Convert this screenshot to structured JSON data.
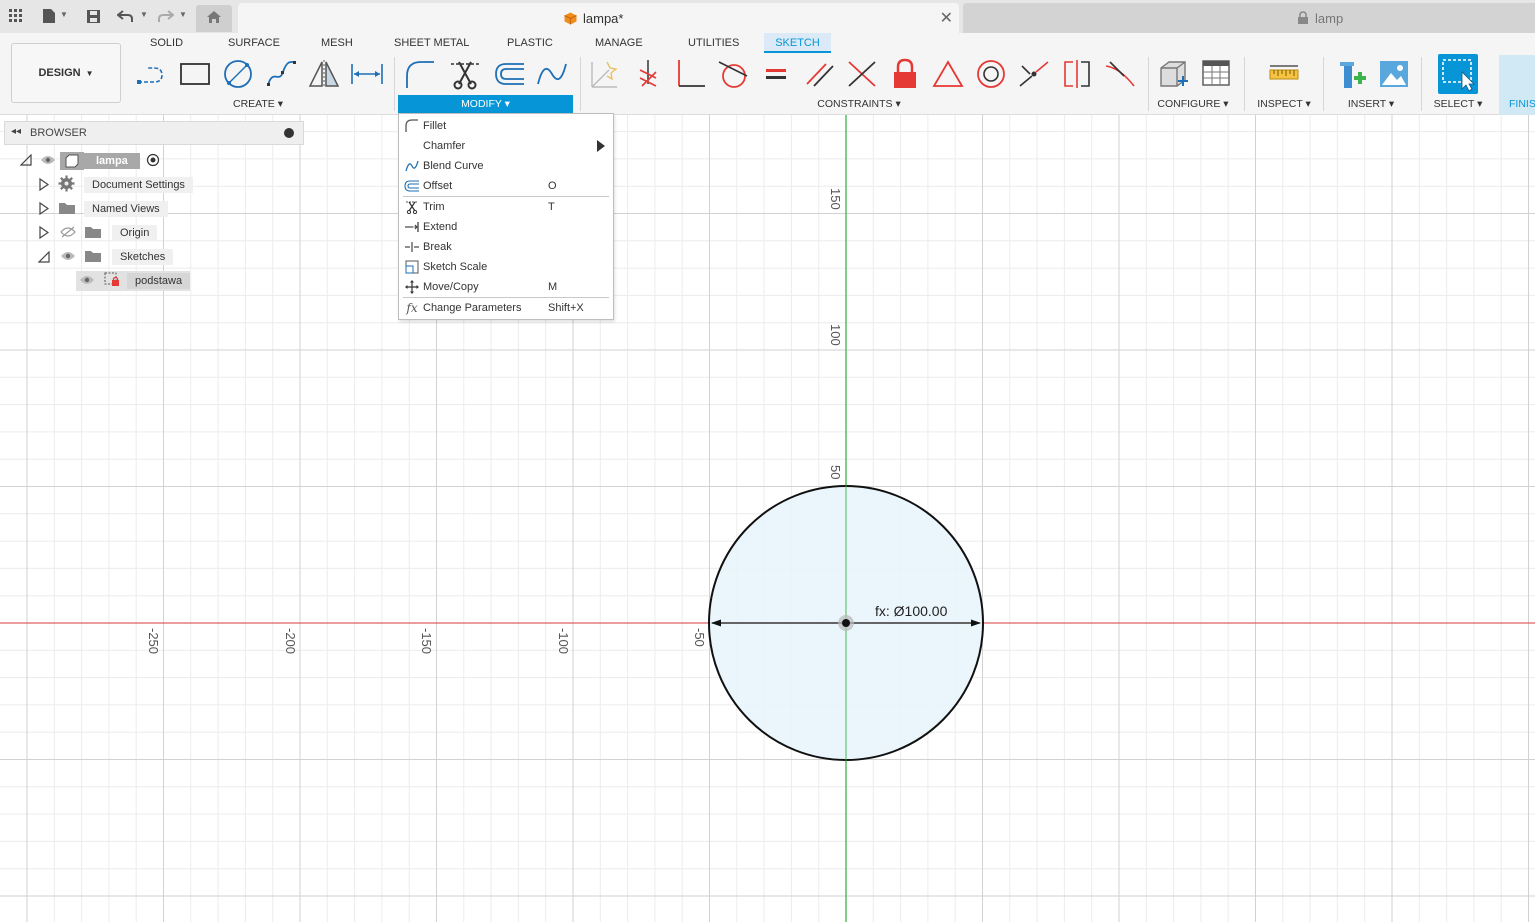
{
  "window": {
    "active_tab": "lampa*",
    "inactive_tab": "lamp"
  },
  "ribbon": {
    "workspace": "DESIGN",
    "tabs": [
      "SOLID",
      "SURFACE",
      "MESH",
      "SHEET METAL",
      "PLASTIC",
      "MANAGE",
      "UTILITIES",
      "SKETCH"
    ],
    "groups": {
      "create": "CREATE",
      "modify": "MODIFY",
      "constraints": "CONSTRAINTS",
      "configure": "CONFIGURE",
      "inspect": "INSPECT",
      "insert": "INSERT",
      "select": "SELECT",
      "finish": "FINISH"
    }
  },
  "browser": {
    "title": "BROWSER",
    "root": "lampa",
    "items": [
      {
        "label": "Document Settings"
      },
      {
        "label": "Named Views"
      },
      {
        "label": "Origin"
      },
      {
        "label": "Sketches"
      },
      {
        "label": "podstawa"
      }
    ]
  },
  "modify_menu": {
    "items": [
      {
        "label": "Fillet",
        "shortcut": ""
      },
      {
        "label": "Chamfer",
        "shortcut": ""
      },
      {
        "label": "Blend Curve",
        "shortcut": ""
      },
      {
        "label": "Offset",
        "shortcut": "O"
      },
      {
        "label": "Trim",
        "shortcut": "T"
      },
      {
        "label": "Extend",
        "shortcut": ""
      },
      {
        "label": "Break",
        "shortcut": ""
      },
      {
        "label": "Sketch Scale",
        "shortcut": ""
      },
      {
        "label": "Move/Copy",
        "shortcut": "M"
      },
      {
        "label": "Change Parameters",
        "shortcut": "Shift+X"
      }
    ]
  },
  "canvas": {
    "vertical_ruler": [
      "150",
      "100",
      "50"
    ],
    "horizontal_ruler": [
      "-250",
      "-200",
      "-150",
      "-100",
      "-50"
    ],
    "dimension": "fx: Ø100.00"
  },
  "colors": {
    "accent": "#0696d7",
    "x_axis": "#e06060",
    "y_axis": "#3cb44b",
    "sketch_fill": "#e8f4fb"
  }
}
